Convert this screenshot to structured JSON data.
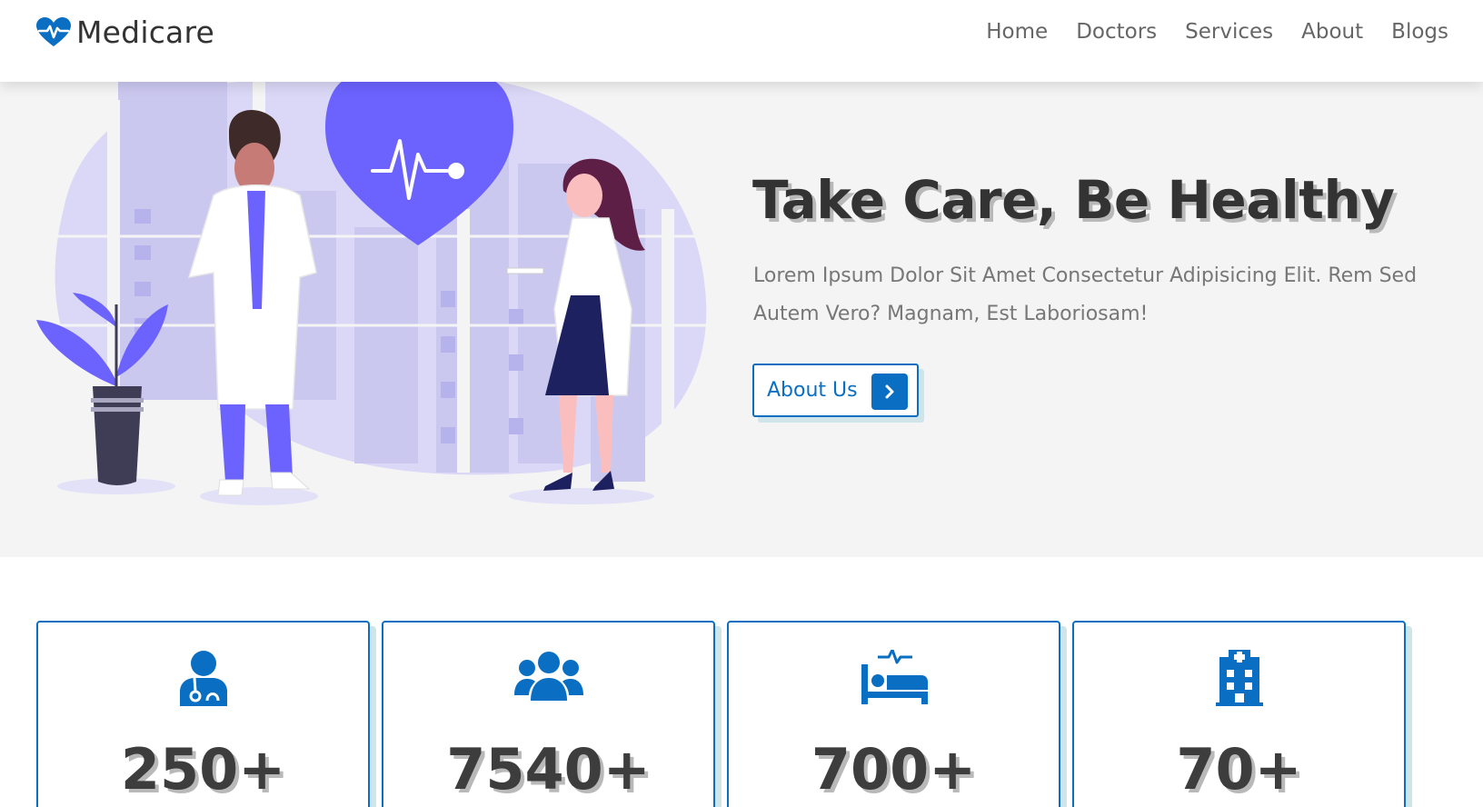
{
  "brand": {
    "name": "Medicare",
    "icon": "heartbeat-icon",
    "color": "#0a6fc2"
  },
  "nav": {
    "items": [
      {
        "label": "Home"
      },
      {
        "label": "Doctors"
      },
      {
        "label": "Services"
      },
      {
        "label": "About"
      },
      {
        "label": "Blogs"
      }
    ]
  },
  "hero": {
    "title": "Take Care, Be Healthy",
    "text": "Lorem Ipsum Dolor Sit Amet Consectetur Adipisicing Elit. Rem Sed Autem Vero? Magnam, Est Laboriosam!",
    "button_label": "About Us",
    "button_icon": "chevron-right-icon",
    "illustration_accent": "#6c63ff"
  },
  "stats": [
    {
      "icon": "user-doctor-icon",
      "value": "250+"
    },
    {
      "icon": "users-icon",
      "value": "7540+"
    },
    {
      "icon": "procedures-bed-icon",
      "value": "700+"
    },
    {
      "icon": "hospital-icon",
      "value": "70+"
    }
  ]
}
